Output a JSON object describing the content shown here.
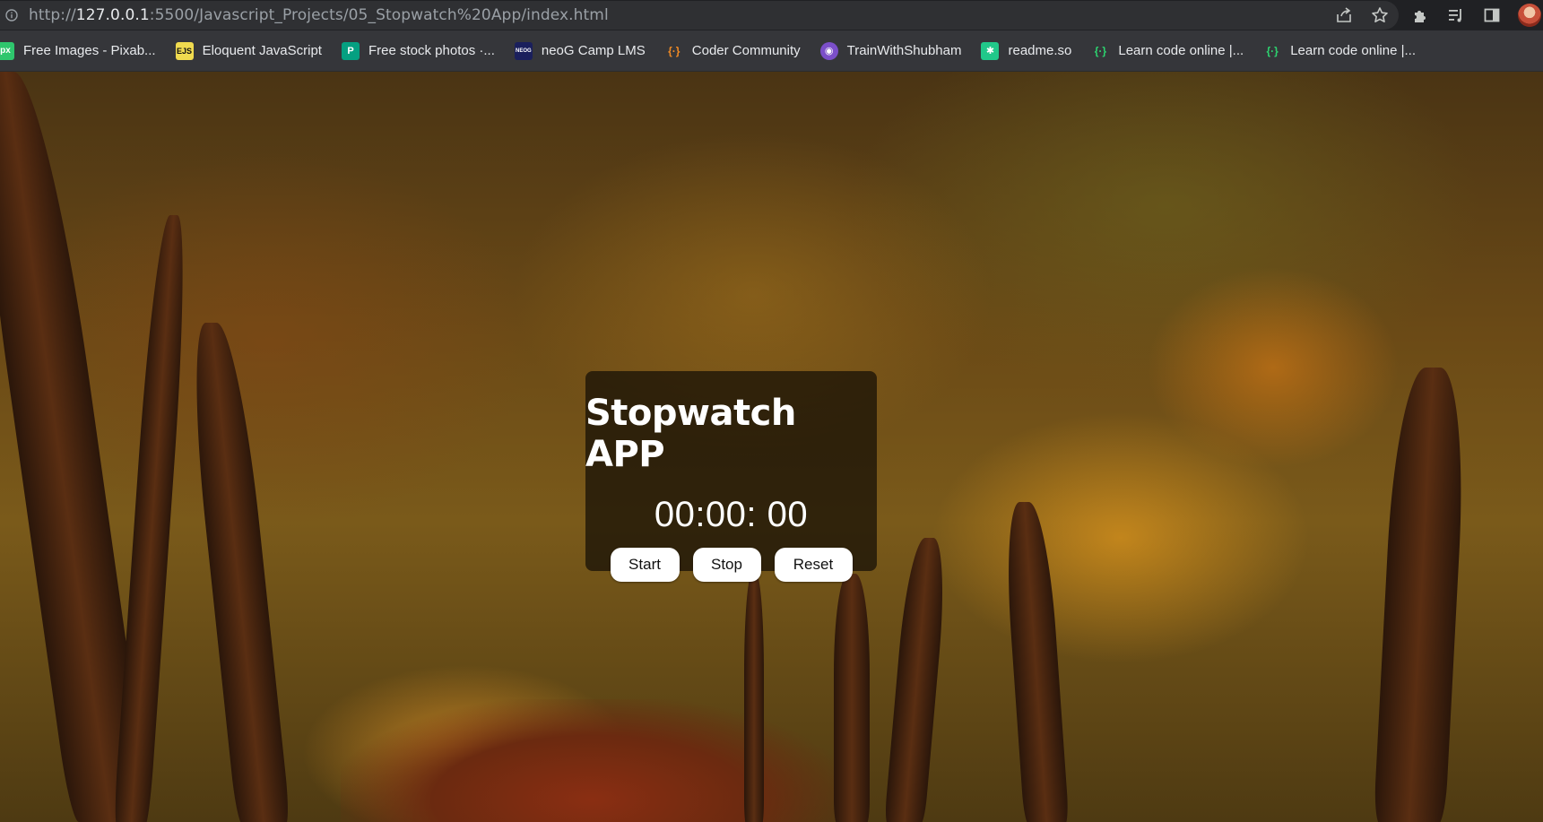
{
  "browser": {
    "url_prefix": "http://",
    "url_host": "127.0.0.1",
    "url_rest": ":5500/Javascript_Projects/05_Stopwatch%20App/index.html"
  },
  "bookmarks": [
    {
      "label": "Free Images - Pixab...",
      "icon": "pixabay-icon",
      "color": "#2ec66d",
      "glyph": "px"
    },
    {
      "label": "Eloquent JavaScript",
      "icon": "eloquent-js-icon",
      "color": "#f0db4f",
      "glyph": "EJS"
    },
    {
      "label": "Free stock photos ·...",
      "icon": "pexels-icon",
      "color": "#05a081",
      "glyph": "P"
    },
    {
      "label": "neoG Camp LMS",
      "icon": "neog-icon",
      "color": "#1a1f5c",
      "glyph": "NEOG"
    },
    {
      "label": "Coder Community",
      "icon": "coder-community-icon",
      "color": "#f08a24",
      "glyph": "{·}"
    },
    {
      "label": "TrainWithShubham",
      "icon": "trainwithshubham-icon",
      "color": "#7b4fc9",
      "glyph": "◉"
    },
    {
      "label": "readme.so",
      "icon": "readme-icon",
      "color": "#21c88a",
      "glyph": "✱"
    },
    {
      "label": "Learn code online |...",
      "icon": "codedamn-icon",
      "color": "#2dd36f",
      "glyph": "{·}"
    },
    {
      "label": "Learn code online |...",
      "icon": "codedamn-icon",
      "color": "#2dd36f",
      "glyph": "{·}"
    }
  ],
  "app": {
    "title": "Stopwatch APP",
    "timer": "00:00: 00",
    "buttons": {
      "start": "Start",
      "stop": "Stop",
      "reset": "Reset"
    }
  }
}
